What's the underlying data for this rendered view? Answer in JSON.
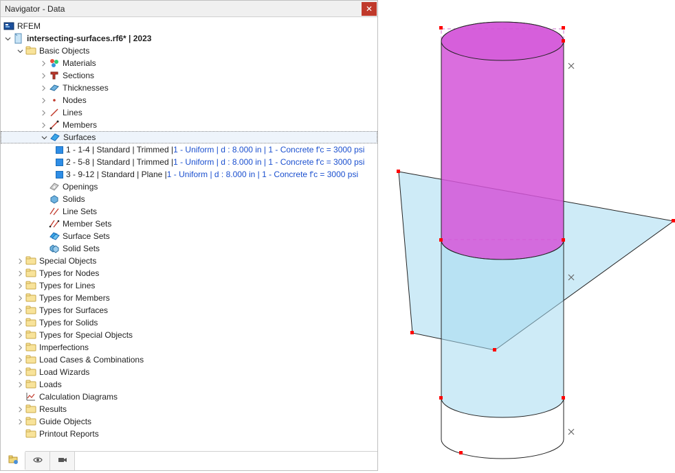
{
  "titlebar": {
    "title": "Navigator - Data",
    "close": "✕"
  },
  "root": {
    "label": "RFEM"
  },
  "file": {
    "label": "intersecting-surfaces.rf6* | 2023"
  },
  "basic_objects": {
    "label": "Basic Objects",
    "materials": "Materials",
    "sections": "Sections",
    "thicknesses": "Thicknesses",
    "nodes": "Nodes",
    "lines": "Lines",
    "members": "Members",
    "surfaces": {
      "label": "Surfaces",
      "items": [
        {
          "prefix": "1 - 1-4 | Standard | Trimmed | ",
          "link": "1 - Uniform | d : 8.000 in | 1 - Concrete f'c = 3000 psi"
        },
        {
          "prefix": "2 - 5-8 | Standard | Trimmed | ",
          "link": "1 - Uniform | d : 8.000 in | 1 - Concrete f'c = 3000 psi"
        },
        {
          "prefix": "3 - 9-12 | Standard | Plane | ",
          "link": "1 - Uniform | d : 8.000 in | 1 - Concrete f'c = 3000 psi"
        }
      ]
    },
    "openings": "Openings",
    "solids": "Solids",
    "line_sets": "Line Sets",
    "member_sets": "Member Sets",
    "surface_sets": "Surface Sets",
    "solid_sets": "Solid Sets"
  },
  "folders": {
    "special_objects": "Special Objects",
    "types_for_nodes": "Types for Nodes",
    "types_for_lines": "Types for Lines",
    "types_for_members": "Types for Members",
    "types_for_surfaces": "Types for Surfaces",
    "types_for_solids": "Types for Solids",
    "types_for_special_objects": "Types for Special Objects",
    "imperfections": "Imperfections",
    "load_cases_combinations": "Load Cases & Combinations",
    "load_wizards": "Load Wizards",
    "loads": "Loads",
    "calculation_diagrams": "Calculation Diagrams",
    "results": "Results",
    "guide_objects": "Guide Objects",
    "printout_reports": "Printout Reports"
  }
}
